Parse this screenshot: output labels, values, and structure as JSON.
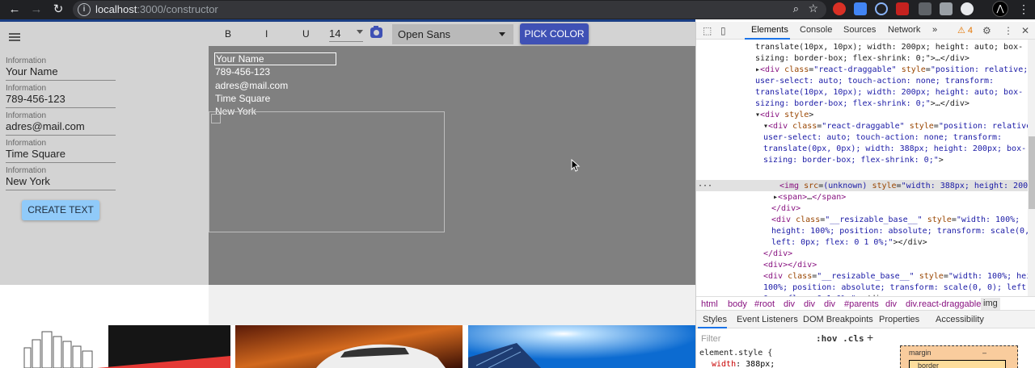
{
  "browser": {
    "url_host": "localhost",
    "url_path": ":3000/constructor",
    "extension_badge": "4"
  },
  "left_panel": {
    "fields": [
      {
        "label": "Information",
        "value": "Your Name"
      },
      {
        "label": "Information",
        "value": "789-456-123"
      },
      {
        "label": "Information",
        "value": "adres@mail.com"
      },
      {
        "label": "Information",
        "value": "Time Square"
      },
      {
        "label": "Information",
        "value": "New York"
      }
    ],
    "create_button": "CREATE TEXT"
  },
  "toolbar": {
    "bold": "B",
    "italic": "I",
    "underline": "U",
    "font_size": "14",
    "font_family": "Open Sans",
    "pick_color": "PICK COLOR"
  },
  "canvas": {
    "name": "Your Name",
    "lines": [
      "789-456-123",
      "adres@mail.com",
      "Time Square",
      "New York"
    ]
  },
  "devtools": {
    "tabs": [
      "Elements",
      "Console",
      "Sources",
      "Network"
    ],
    "more_tabs": "»",
    "warnings": "4",
    "breadcrumbs": [
      "html",
      "body",
      "#root",
      "div",
      "div",
      "div",
      "#parents",
      "div",
      "div.react-draggable",
      "img"
    ],
    "styles_tabs": [
      "Styles",
      "Event Listeners",
      "DOM Breakpoints",
      "Properties",
      "Accessibility"
    ],
    "filter_placeholder": "Filter",
    "hov": ":hov",
    "cls": ".cls",
    "element_style": "element.style {",
    "width_prop": "width",
    "width_val": "388px;",
    "box_margin": "margin",
    "box_margin_val": "–",
    "box_border": "border",
    "ellipsis": "…"
  },
  "colors": {
    "accent": "#3f51b5",
    "create_button": "#90caf9",
    "canvas_bg": "#808080",
    "panel_bg": "#d3d3d3"
  }
}
